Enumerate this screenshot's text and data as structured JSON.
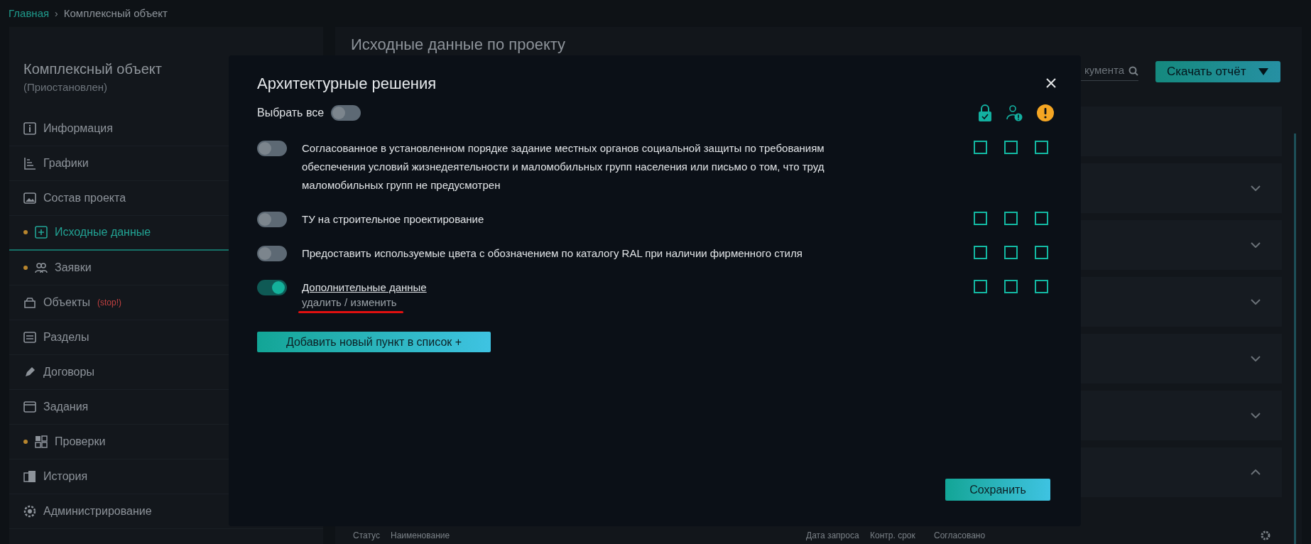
{
  "breadcrumb": {
    "separator": "›",
    "items": [
      {
        "label": "Главная",
        "kind": "link"
      },
      {
        "label": "Комплексный объект",
        "kind": "current"
      }
    ]
  },
  "sidebar": {
    "title": "Комплексный объект",
    "status": "(Приостановлен)",
    "items": [
      {
        "label": "Информация",
        "selected": false,
        "dot": false
      },
      {
        "label": "Графики",
        "selected": false,
        "dot": false
      },
      {
        "label": "Состав проекта",
        "selected": false,
        "dot": false
      },
      {
        "label": "Исходные данные",
        "selected": true,
        "dot": true
      },
      {
        "label": "Заявки",
        "selected": false,
        "dot": true
      },
      {
        "label": "Объекты",
        "selected": false,
        "dot": false,
        "badge": "(stop!)"
      },
      {
        "label": "Разделы",
        "selected": false,
        "dot": false
      },
      {
        "label": "Договоры",
        "selected": false,
        "dot": false
      },
      {
        "label": "Задания",
        "selected": false,
        "dot": false
      },
      {
        "label": "Проверки",
        "selected": false,
        "dot": true
      },
      {
        "label": "История",
        "selected": false,
        "dot": false
      },
      {
        "label": "Администрирование",
        "selected": false,
        "dot": false
      }
    ]
  },
  "main": {
    "title": "Исходные данные по проекту",
    "search": {
      "placeholder": "кумента"
    },
    "download_button": "Скачать отчёт",
    "sections": [
      {
        "kind": "plain"
      },
      {
        "kind": "collapsed"
      },
      {
        "kind": "collapsed"
      },
      {
        "kind": "collapsed"
      },
      {
        "kind": "collapsed"
      },
      {
        "kind": "collapsed"
      },
      {
        "kind": "expanded"
      }
    ],
    "table_columns": [
      "Статус",
      "Наименование",
      "Дата запроса",
      "Контр. срок",
      "Согласовано"
    ]
  },
  "dialog": {
    "title": "Архитектурные решения",
    "select_all": {
      "label": "Выбрать все",
      "on": false
    },
    "items": [
      {
        "text": "Согласованное в установленном порядке задание местных органов социальной защиты по требованиям обеспечения условий жизнедеятельности и маломобильных групп населения или письмо о том, что труд маломобильных групп не предусмотрен",
        "on": false,
        "kind": "standard",
        "checks": [
          false,
          false,
          false
        ]
      },
      {
        "text": "ТУ на строительное проектирование",
        "on": false,
        "kind": "standard",
        "checks": [
          false,
          false,
          false
        ]
      },
      {
        "text": "Предоставить используемые цвета с обозначением по каталогу RAL при наличии фирменного стиля",
        "on": false,
        "kind": "standard",
        "checks": [
          false,
          false,
          false
        ]
      },
      {
        "text": "Дополнительные данные",
        "on": true,
        "kind": "custom",
        "action": "удалить / изменить",
        "checks": [
          false,
          false,
          false
        ]
      }
    ],
    "add_button": "Добавить новый пункт в список +",
    "save_button": "Сохранить"
  }
}
